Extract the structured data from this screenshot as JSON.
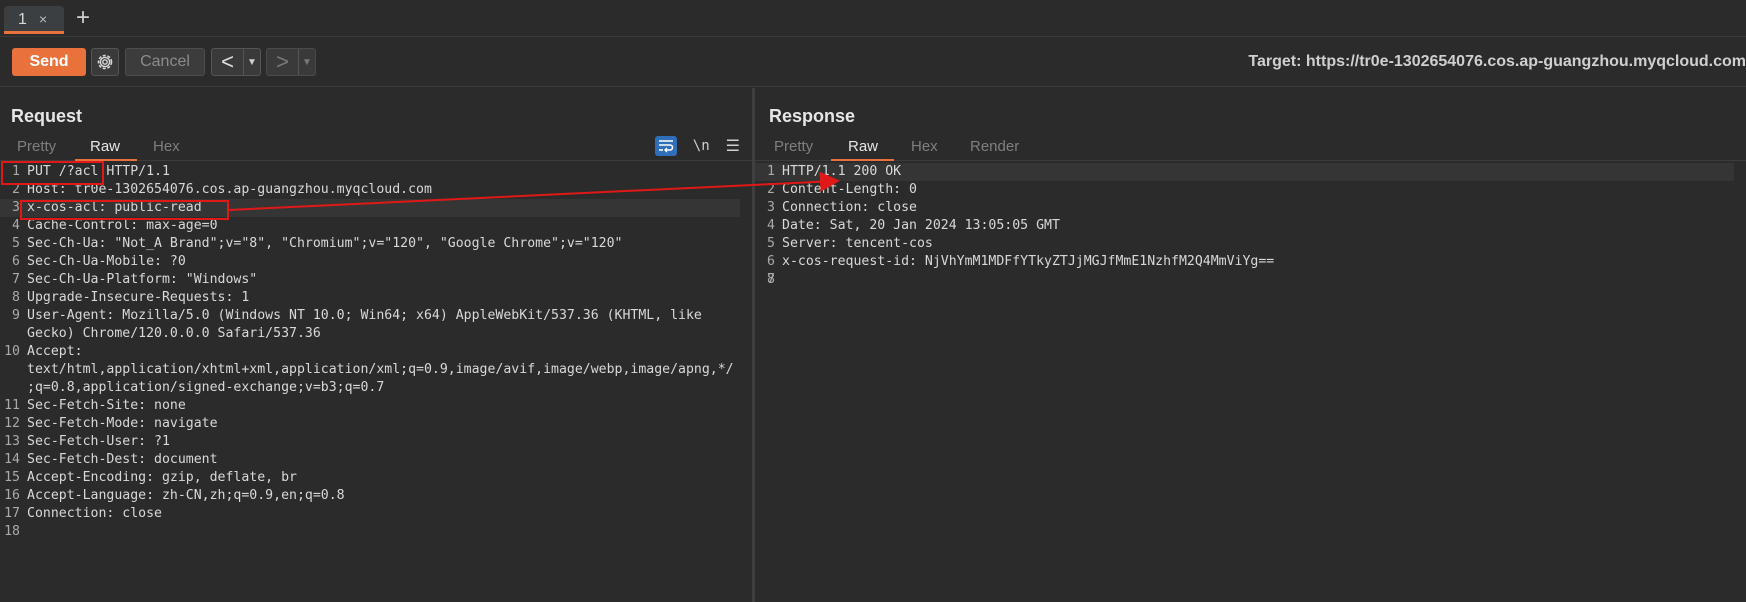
{
  "tabs": [
    {
      "label": "1",
      "close": "×"
    }
  ],
  "new_tab": "+",
  "toolbar": {
    "send_label": "Send",
    "cancel_label": "Cancel",
    "back_arrow": "<",
    "forward_arrow": ">",
    "dropdown_glyph": "▼",
    "target_prefix": "Target: ",
    "target_url": "https://tr0e-1302654076.cos.ap-guangzhou.myqcloud.com"
  },
  "request": {
    "title": "Request",
    "tabs": [
      "Pretty",
      "Raw",
      "Hex"
    ],
    "active_tab": "Raw",
    "newline_toggle": "\\n",
    "lines": [
      {
        "n": "1",
        "text": "PUT /?acl HTTP/1.1"
      },
      {
        "n": "2",
        "text": "Host: tr0e-1302654076.cos.ap-guangzhou.myqcloud.com"
      },
      {
        "n": "3",
        "text": "x-cos-acl: public-read"
      },
      {
        "n": "4",
        "text": "Cache-Control: max-age=0"
      },
      {
        "n": "5",
        "text": "Sec-Ch-Ua: \"Not_A Brand\";v=\"8\", \"Chromium\";v=\"120\", \"Google Chrome\";v=\"120\""
      },
      {
        "n": "6",
        "text": "Sec-Ch-Ua-Mobile: ?0"
      },
      {
        "n": "7",
        "text": "Sec-Ch-Ua-Platform: \"Windows\""
      },
      {
        "n": "8",
        "text": "Upgrade-Insecure-Requests: 1"
      },
      {
        "n": "9",
        "text": "User-Agent: Mozilla/5.0 (Windows NT 10.0; Win64; x64) AppleWebKit/537.36 (KHTML, like",
        "cont": "Gecko) Chrome/120.0.0.0 Safari/537.36"
      },
      {
        "n": "10",
        "text": "Accept:",
        "cont": "text/html,application/xhtml+xml,application/xml;q=0.9,image/avif,image/webp,image/apng,*/",
        "cont2": ";q=0.8,application/signed-exchange;v=b3;q=0.7"
      },
      {
        "n": "11",
        "text": "Sec-Fetch-Site: none"
      },
      {
        "n": "12",
        "text": "Sec-Fetch-Mode: navigate"
      },
      {
        "n": "13",
        "text": "Sec-Fetch-User: ?1"
      },
      {
        "n": "14",
        "text": "Sec-Fetch-Dest: document"
      },
      {
        "n": "15",
        "text": "Accept-Encoding: gzip, deflate, br"
      },
      {
        "n": "16",
        "text": "Accept-Language: zh-CN,zh;q=0.9,en;q=0.8"
      },
      {
        "n": "17",
        "text": "Connection: close"
      },
      {
        "n": "18",
        "text": ""
      }
    ]
  },
  "response": {
    "title": "Response",
    "tabs": [
      "Pretty",
      "Raw",
      "Hex",
      "Render"
    ],
    "active_tab": "Raw",
    "lines": [
      {
        "n": "1",
        "text": "HTTP/1.1 200 OK"
      },
      {
        "n": "2",
        "text": "Content-Length: 0"
      },
      {
        "n": "3",
        "text": "Connection: close"
      },
      {
        "n": "4",
        "text": "Date: Sat, 20 Jan 2024 13:05:05 GMT"
      },
      {
        "n": "5",
        "text": "Server: tencent-cos"
      },
      {
        "n": "6",
        "text": "x-cos-request-id: NjVhYmM1MDFfYTkyZTJjMGJfMmE1NzhfM2Q4MmViYg=="
      },
      {
        "n": "7",
        "text": ""
      },
      {
        "n": "8",
        "text": ""
      }
    ]
  },
  "colors": {
    "accent": "#e8713c",
    "annotation": "#e01818",
    "wrap_toggle": "#2f6eb8"
  }
}
